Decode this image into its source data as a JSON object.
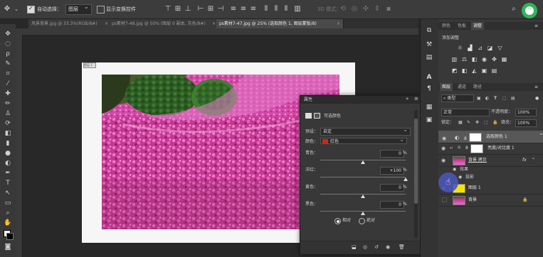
{
  "options_bar": {
    "auto_select_label": "自动选择：",
    "auto_select_value": "图层",
    "show_transform_label": "显示变换控件",
    "mode_3d_label": "3D 模式："
  },
  "tabs": [
    {
      "label": "风景背景.jpg @ 33.3%(RGB/8#)",
      "close": "×"
    },
    {
      "label": "ps素材7-48.jpg @ 50% (图层 0 副本, 灰色/8#)",
      "close": "×"
    },
    {
      "label": "ps素材7-47.jpg @ 25% (选取颜色 1, 图层蒙版/8)",
      "close": "×"
    }
  ],
  "document": {
    "corner_label": "图层 1"
  },
  "properties": {
    "title": "属性",
    "subtitle": "可选颜色",
    "preset_label": "预设：",
    "preset_value": "自定",
    "colors_label": "颜色：",
    "colors_value": "红色",
    "colors_swatch": "#c8291c",
    "sliders": [
      {
        "label": "青色：",
        "value": "0",
        "unit": "%",
        "level": 0
      },
      {
        "label": "洋红：",
        "value": "+100",
        "unit": "%",
        "level": 100
      },
      {
        "label": "黄色：",
        "value": "0",
        "unit": "%",
        "level": 0
      },
      {
        "label": "黑色：",
        "value": "0",
        "unit": "%",
        "level": 0
      }
    ],
    "method_relative": "相对",
    "method_absolute": "绝对"
  },
  "right_panel": {
    "top_tabs": [
      "颜色",
      "色板",
      "调整"
    ],
    "adjust_title": "添加调整",
    "layer_tabs": [
      "图层",
      "通道",
      "路径"
    ],
    "filter_value": "类型",
    "blend_value": "正常",
    "opacity_label": "不透明度：",
    "opacity_value": "100%",
    "lock_label": "锁定：",
    "fill_label": "填充：",
    "fill_value": "100%",
    "layers": [
      {
        "name": "选取颜色 1",
        "selected": true
      },
      {
        "name": "亮度/对比度 1",
        "selected": false
      },
      {
        "name": "背景 拷贝",
        "selected": false,
        "fx": "fx"
      },
      {
        "name": "效果",
        "selected": false
      },
      {
        "name": "投影",
        "selected": false
      },
      {
        "name": "图层 1",
        "selected": false
      },
      {
        "name": "背景",
        "selected": false
      }
    ]
  },
  "colors": {
    "accent": "#2b9bd6",
    "cursor": "#4a55b8",
    "layer_yellow": "#f2e600"
  }
}
